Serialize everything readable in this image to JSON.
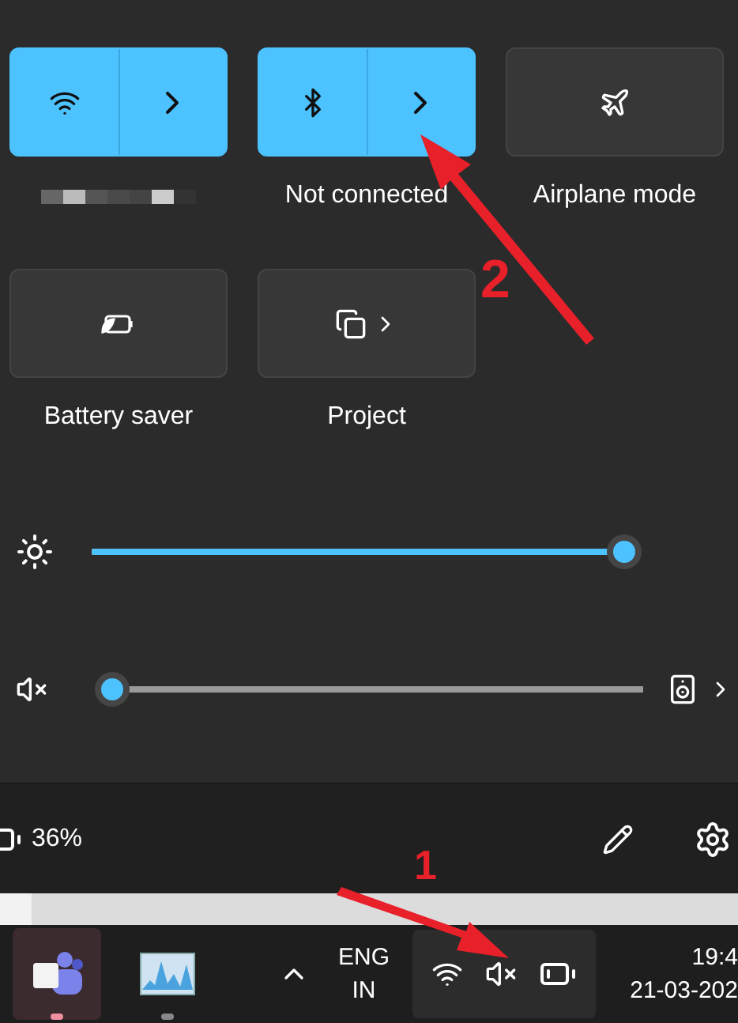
{
  "tiles": [
    {
      "kind": "wifi",
      "on": true,
      "split": true,
      "label_hidden": true
    },
    {
      "kind": "bluetooth",
      "on": true,
      "split": true,
      "label": "Not connected"
    },
    {
      "kind": "airplane",
      "on": false,
      "split": false,
      "label": "Airplane mode"
    },
    {
      "kind": "battery_saver",
      "on": false,
      "split": false,
      "label": "Battery saver"
    },
    {
      "kind": "project",
      "on": false,
      "split": false,
      "label": "Project"
    }
  ],
  "sliders": [
    {
      "kind": "brightness",
      "level": 1
    },
    {
      "kind": "volume",
      "level": 0,
      "muted": true
    }
  ],
  "footer": {
    "battery": "36%"
  },
  "taskbar": {
    "apps": [
      {
        "kind": "teams",
        "selected": true
      },
      {
        "kind": "monitor",
        "selected": false
      }
    ],
    "language": [
      "ENG",
      "IN"
    ],
    "volume_muted": true,
    "time": "19:4",
    "date": "21-03-202"
  },
  "annotations": [
    {
      "label": "2"
    },
    {
      "label": "1"
    }
  ]
}
